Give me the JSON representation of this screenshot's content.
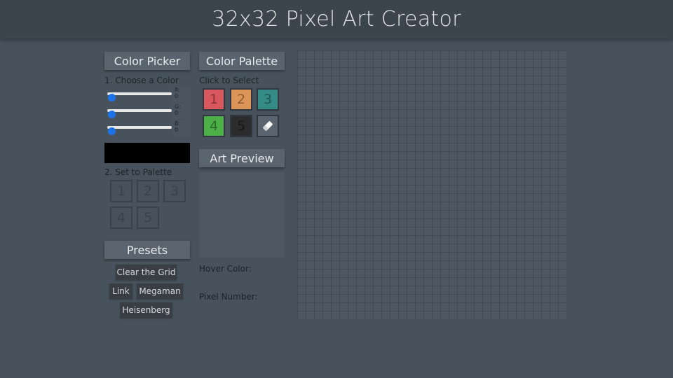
{
  "header": {
    "title": "32x32 Pixel Art Creator"
  },
  "color_picker": {
    "title": "Color Picker",
    "step1": "1. Choose a Color",
    "sliders": [
      {
        "label": "R:",
        "value": "0"
      },
      {
        "label": "G:",
        "value": "0"
      },
      {
        "label": "B:",
        "value": "0"
      }
    ],
    "current_color": "#000000",
    "step2": "2. Set to Palette",
    "slots": [
      "1",
      "2",
      "3",
      "4",
      "5"
    ]
  },
  "presets": {
    "title": "Presets",
    "clear": "Clear the Grid",
    "link": "Link",
    "megaman": "Megaman",
    "heisenberg": "Heisenberg"
  },
  "palette": {
    "title": "Color Palette",
    "subtitle": "Click to Select",
    "swatches": [
      {
        "label": "1",
        "color": "#d9585e"
      },
      {
        "label": "2",
        "color": "#dd9458"
      },
      {
        "label": "3",
        "color": "#358c87"
      },
      {
        "label": "4",
        "color": "#4caf48"
      },
      {
        "label": "5",
        "color": "#2c2c2c"
      }
    ],
    "eraser_icon": "eraser-icon"
  },
  "preview": {
    "title": "Art Preview",
    "hover_color_label": "Hover Color:",
    "pixel_number_label": "Pixel Number:"
  },
  "canvas": {
    "grid": "32x32"
  }
}
